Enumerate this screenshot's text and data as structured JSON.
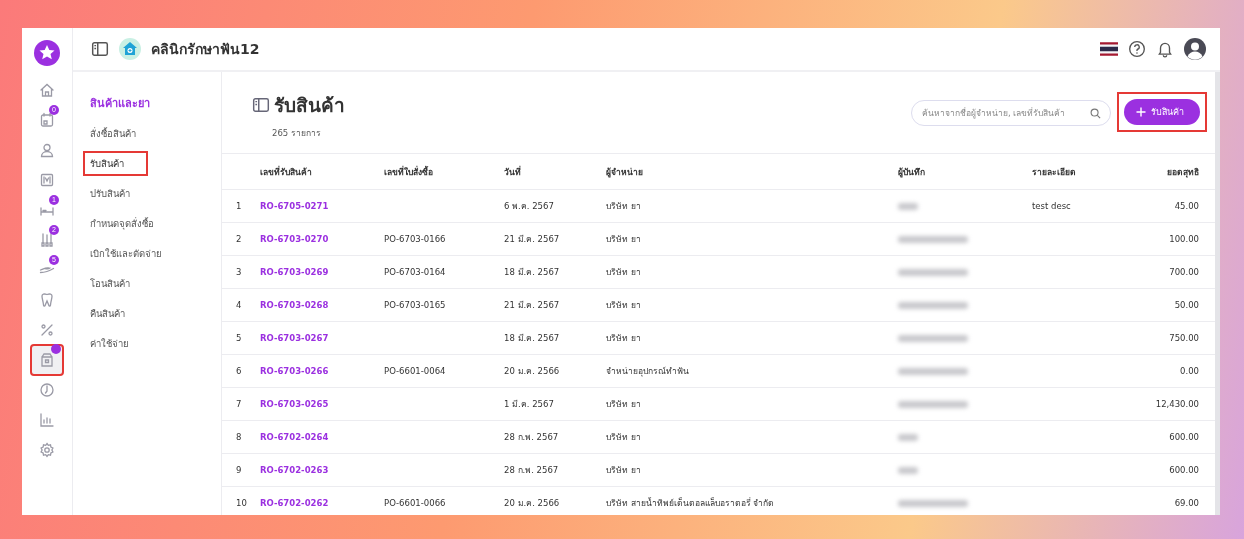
{
  "topbar": {
    "clinic_name": "คลินิกรักษาฟัน12"
  },
  "rail": [
    {
      "kind": "home",
      "selected": false,
      "highlighted": false
    },
    {
      "kind": "calendar",
      "badge": "0",
      "selected": false,
      "highlighted": false
    },
    {
      "kind": "user",
      "selected": false,
      "highlighted": false
    },
    {
      "kind": "xray",
      "selected": false,
      "highlighted": false
    },
    {
      "kind": "bed",
      "badge": "1",
      "selected": false,
      "highlighted": false
    },
    {
      "kind": "tools",
      "badge": "2",
      "selected": false,
      "highlighted": false
    },
    {
      "kind": "hand",
      "badge": "5",
      "selected": false,
      "highlighted": false
    },
    {
      "kind": "tooth",
      "selected": false,
      "highlighted": false
    },
    {
      "kind": "percent",
      "selected": false,
      "highlighted": false
    },
    {
      "kind": "box",
      "dot": true,
      "selected": true,
      "highlighted": true
    },
    {
      "kind": "gauge",
      "selected": false,
      "highlighted": false
    },
    {
      "kind": "chart",
      "selected": false,
      "highlighted": false
    },
    {
      "kind": "gear",
      "selected": false,
      "highlighted": false
    }
  ],
  "submenu": {
    "heading": "สินค้าและยา",
    "items": [
      {
        "label": "สั่งซื้อสินค้า",
        "selected": false,
        "highlighted": false
      },
      {
        "label": "รับสินค้า",
        "selected": true,
        "highlighted": true
      },
      {
        "label": "ปรับสินค้า",
        "selected": false,
        "highlighted": false
      },
      {
        "label": "กำหนดจุดสั่งซื้อ",
        "selected": false,
        "highlighted": false
      },
      {
        "label": "เบิกใช้และตัดจ่าย",
        "selected": false,
        "highlighted": false
      },
      {
        "label": "โอนสินค้า",
        "selected": false,
        "highlighted": false
      },
      {
        "label": "คืนสินค้า",
        "selected": false,
        "highlighted": false
      },
      {
        "label": "ค่าใช้จ่าย",
        "selected": false,
        "highlighted": false
      }
    ]
  },
  "page": {
    "title": "รับสินค้า",
    "count": "265 รายการ",
    "search": {
      "placeholder": "ค้นหาจากชื่อผู้จำหน่าย, เลขที่รับสินค้า"
    },
    "add_button": {
      "label": "รับสินค้า",
      "highlighted": true
    }
  },
  "table": {
    "columns": [
      "",
      "เลขที่รับสินค้า",
      "เลขที่ใบสั่งซื้อ",
      "วันที่",
      "ผู้จำหน่าย",
      "ผู้บันทึก",
      "รายละเอียด",
      "ยอดสุทธิ"
    ],
    "rows": [
      {
        "no": "1",
        "receipt": "RO-6705-0271",
        "po": "",
        "date": "6 พ.ค. 2567",
        "vendor": "บริษัท ยา",
        "detail": "test desc",
        "net": "45.00"
      },
      {
        "no": "2",
        "receipt": "RO-6703-0270",
        "po": "PO-6703-0166",
        "date": "21 มี.ค. 2567",
        "vendor": "บริษัท ยา",
        "detail": "",
        "net": "100.00"
      },
      {
        "no": "3",
        "receipt": "RO-6703-0269",
        "po": "PO-6703-0164",
        "date": "18 มี.ค. 2567",
        "vendor": "บริษัท ยา",
        "detail": "",
        "net": "700.00"
      },
      {
        "no": "4",
        "receipt": "RO-6703-0268",
        "po": "PO-6703-0165",
        "date": "21 มี.ค. 2567",
        "vendor": "บริษัท ยา",
        "detail": "",
        "net": "50.00"
      },
      {
        "no": "5",
        "receipt": "RO-6703-0267",
        "po": "",
        "date": "18 มี.ค. 2567",
        "vendor": "บริษัท ยา",
        "detail": "",
        "net": "750.00"
      },
      {
        "no": "6",
        "receipt": "RO-6703-0266",
        "po": "PO-6601-0064",
        "date": "20 ม.ค. 2566",
        "vendor": "จำหน่ายอุปกรณ์ทำฟัน",
        "detail": "",
        "net": "0.00"
      },
      {
        "no": "7",
        "receipt": "RO-6703-0265",
        "po": "",
        "date": "1 มี.ค. 2567",
        "vendor": "บริษัท ยา",
        "detail": "",
        "net": "12,430.00"
      },
      {
        "no": "8",
        "receipt": "RO-6702-0264",
        "po": "",
        "date": "28 ก.พ. 2567",
        "vendor": "บริษัท ยา",
        "detail": "",
        "net": "600.00"
      },
      {
        "no": "9",
        "receipt": "RO-6702-0263",
        "po": "",
        "date": "28 ก.พ. 2567",
        "vendor": "บริษัท ยา",
        "detail": "",
        "net": "600.00"
      },
      {
        "no": "10",
        "receipt": "RO-6702-0262",
        "po": "PO-6601-0066",
        "date": "20 ม.ค. 2566",
        "vendor": "บริษัท สายน้ำทิพย์เด็นตอลแล็บอราตอรี่ จำกัด",
        "detail": "",
        "net": "69.00"
      }
    ]
  }
}
